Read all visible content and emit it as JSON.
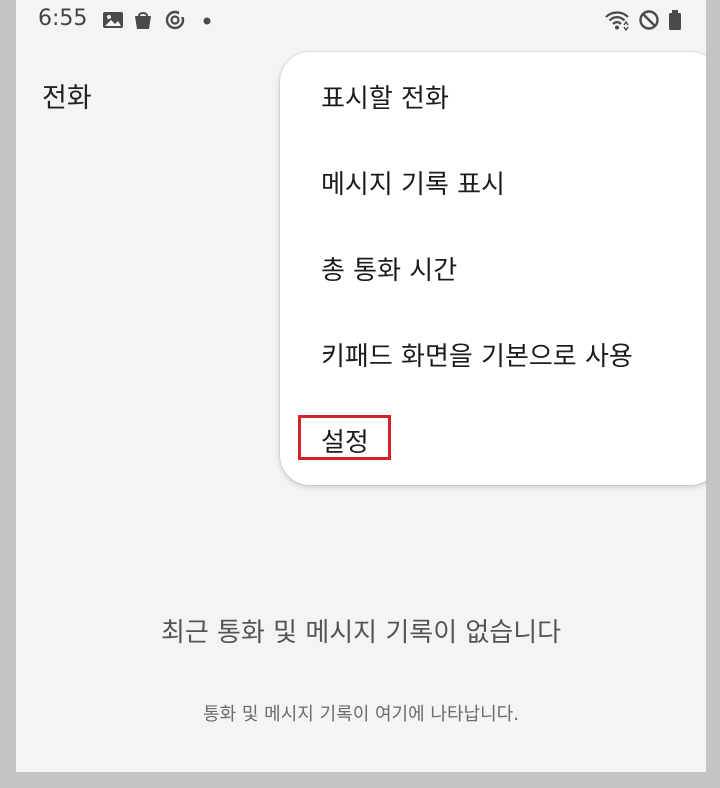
{
  "status_bar": {
    "time": "6:55",
    "left_icons": [
      "gallery-icon",
      "shopping-bag-icon",
      "sync-icon",
      "dot-icon"
    ],
    "right_icons": [
      "wifi-icon",
      "do-not-disturb-icon",
      "battery-icon"
    ]
  },
  "header": {
    "title": "전화"
  },
  "empty_state": {
    "title": "최근 통화 및 메시지 기록이 없습니다",
    "subtitle": "통화 및 메시지 기록이 여기에 나타납니다."
  },
  "menu": {
    "items": [
      {
        "label": "표시할 전화"
      },
      {
        "label": "메시지 기록 표시"
      },
      {
        "label": "총 통화 시간"
      },
      {
        "label": "키패드 화면을 기본으로 사용"
      },
      {
        "label": "설정",
        "highlighted": true
      }
    ]
  },
  "colors": {
    "background": "#f4f4f4",
    "menu_background": "#ffffff",
    "highlight_border": "#d2232a",
    "outer_frame": "#c4c4c4"
  }
}
